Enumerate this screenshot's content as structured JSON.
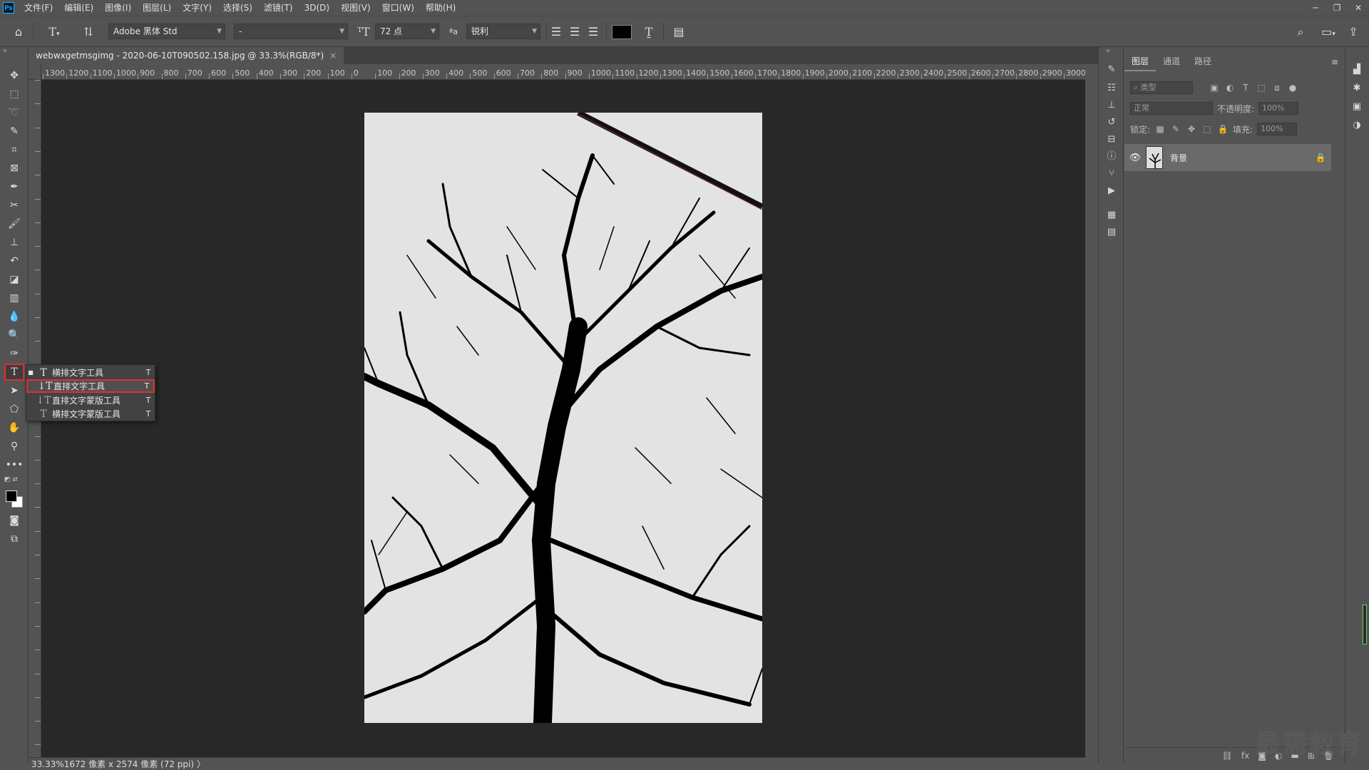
{
  "app": {
    "logo_text": "Ps",
    "menu": [
      "文件(F)",
      "编辑(E)",
      "图像(I)",
      "图层(L)",
      "文字(Y)",
      "选择(S)",
      "滤镜(T)",
      "3D(D)",
      "视图(V)",
      "窗口(W)",
      "帮助(H)"
    ],
    "window_controls": [
      "─",
      "❐",
      "✕"
    ]
  },
  "options": {
    "font_family": "Adobe 黑体 Std",
    "font_style": "-",
    "font_size": "72 点",
    "antialias_label": "ªa",
    "antialias": "锐利",
    "text_color": "#000000"
  },
  "toolbar": {
    "tools": [
      "move-tool",
      "marquee-tool",
      "lasso-tool",
      "quick-select-tool",
      "crop-tool",
      "frame-tool",
      "eyedropper-tool",
      "healing-tool",
      "brush-tool",
      "stamp-tool",
      "history-brush-tool",
      "eraser-tool",
      "gradient-tool",
      "blur-tool",
      "dodge-tool",
      "pen-tool",
      "type-tool",
      "path-select-tool",
      "shape-tool",
      "hand-tool",
      "zoom-tool",
      "more-tools"
    ],
    "foreground_color": "#000000",
    "background_color": "#ffffff"
  },
  "document": {
    "tab_title": "webwxgetmsgimg - 2020-06-10T090502.158.jpg @ 33.3%(RGB/8*)",
    "close_glyph": "×"
  },
  "ruler": {
    "h_labels": [
      "1300",
      "1200",
      "1100",
      "1000",
      "900",
      "800",
      "700",
      "600",
      "500",
      "400",
      "300",
      "200",
      "100",
      "0",
      "100",
      "200",
      "300",
      "400",
      "500",
      "600",
      "700",
      "800",
      "900",
      "1000",
      "1100",
      "1200",
      "1300",
      "1400",
      "1500",
      "1600",
      "1700",
      "1800",
      "1900",
      "2000",
      "2100",
      "2200",
      "2300",
      "2400",
      "2500",
      "2600",
      "2700",
      "2800",
      "2900",
      "3000"
    ]
  },
  "flyout": {
    "items": [
      {
        "label": "横排文字工具",
        "shortcut": "T",
        "icon": "T",
        "current": true
      },
      {
        "label": "直排文字工具",
        "shortcut": "T",
        "icon": "↓T",
        "current": false
      },
      {
        "label": "直排文字蒙版工具",
        "shortcut": "T",
        "icon": "↓T",
        "current": false
      },
      {
        "label": "横排文字蒙版工具",
        "shortcut": "T",
        "icon": "T",
        "current": false
      }
    ]
  },
  "status": {
    "zoom": "33.33%",
    "info": "1672 像素 x 2574 像素 (72 ppi)",
    "arrow": "〉"
  },
  "layers_panel": {
    "tabs": [
      "图层",
      "通道",
      "路径"
    ],
    "filter_placeholder": "类型",
    "blend_mode": "正常",
    "opacity_label": "不透明度:",
    "opacity": "100%",
    "lock_label": "锁定:",
    "fill_label": "填充:",
    "fill": "100%",
    "layers": [
      {
        "name": "背景",
        "locked": true,
        "visible": true
      }
    ]
  },
  "watermark": "最需教育"
}
